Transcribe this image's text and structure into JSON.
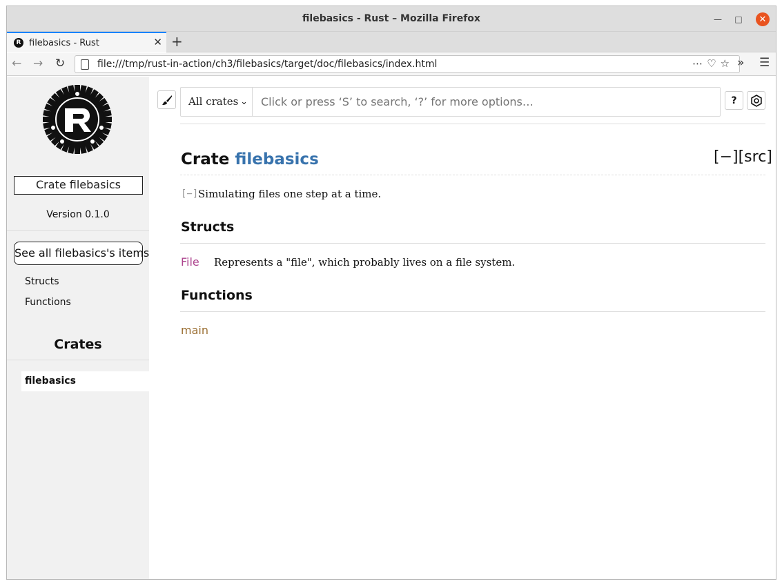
{
  "window": {
    "title": "filebasics - Rust – Mozilla Firefox"
  },
  "tab": {
    "title": "filebasics - Rust",
    "favicon_glyph": "R"
  },
  "nav": {
    "url": "file:///tmp/rust-in-action/ch3/filebasics/target/doc/filebasics/index.html"
  },
  "sidebar": {
    "crate_label": "Crate filebasics",
    "version": "Version 0.1.0",
    "all_items": "See all filebasics's items",
    "links": [
      "Structs",
      "Functions"
    ],
    "crates_heading": "Crates",
    "crates": [
      "filebasics"
    ]
  },
  "search": {
    "crate_filter": "All crates",
    "placeholder": "Click or press ‘S’ to search, ‘?’ for more options…",
    "help_label": "?"
  },
  "main": {
    "title_prefix": "Crate ",
    "crate_name": "filebasics",
    "src_links": "[−][src]",
    "toggle": "[−]",
    "description": "Simulating files one step at a time.",
    "structs_heading": "Structs",
    "structs": [
      {
        "name": "File",
        "desc": "Represents a \"file\", which probably lives on a file system."
      }
    ],
    "functions_heading": "Functions",
    "functions": [
      {
        "name": "main"
      }
    ]
  }
}
